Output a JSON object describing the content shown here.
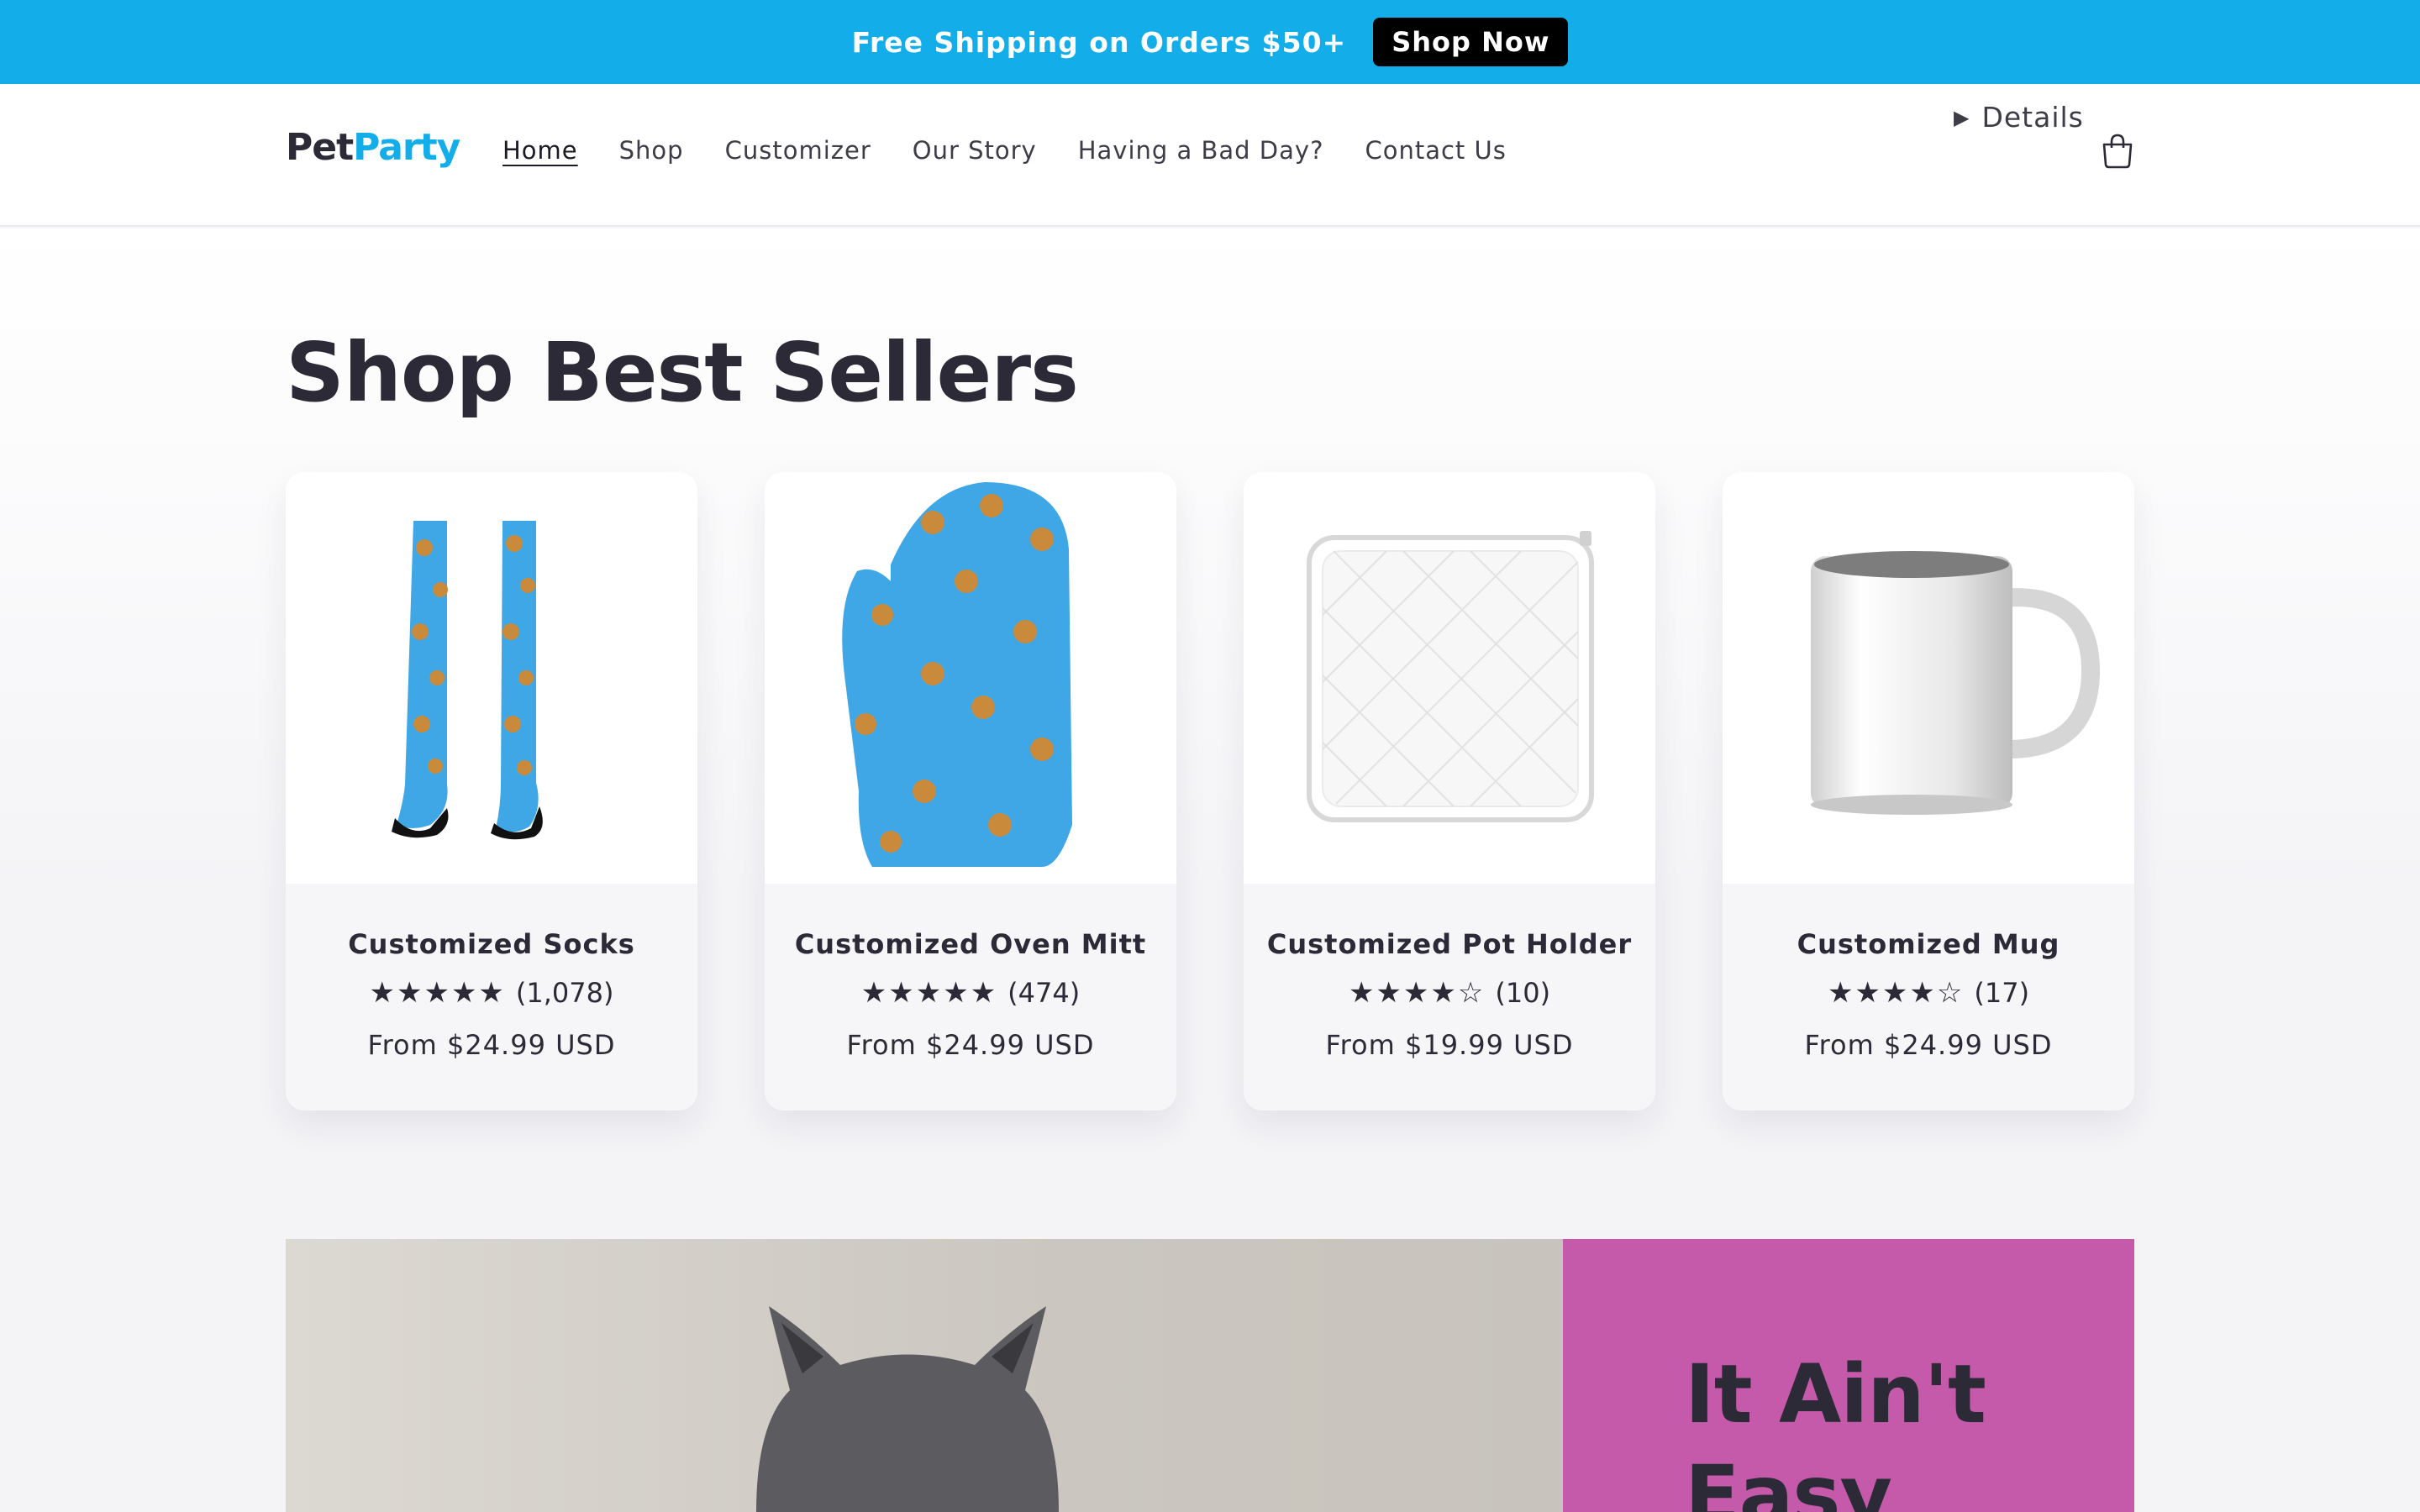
{
  "announcement": {
    "text": "Free Shipping on Orders $50+",
    "button": "Shop Now",
    "bg_color": "#13aeea"
  },
  "header": {
    "logo": {
      "part1": "Pet",
      "part2": "Party"
    },
    "nav": [
      "Home",
      "Shop",
      "Customizer",
      "Our Story",
      "Having a Bad Day?",
      "Contact Us"
    ],
    "active_nav": "Home",
    "details_label": "Details",
    "cart_icon": "cart-icon"
  },
  "best_sellers": {
    "title": "Shop Best Sellers",
    "products": [
      {
        "name": "Customized Socks",
        "stars": "★★★★★",
        "rating_count": "(1,078)",
        "price": "From $24.99 USD",
        "image": "socks"
      },
      {
        "name": "Customized Oven Mitt",
        "stars": "★★★★★",
        "rating_count": "(474)",
        "price": "From $24.99 USD",
        "image": "oven-mitt"
      },
      {
        "name": "Customized Pot Holder",
        "stars": "★★★★☆",
        "rating_count": "(10)",
        "price": "From $19.99 USD",
        "image": "pot-holder"
      },
      {
        "name": "Customized Mug",
        "stars": "★★★★☆",
        "rating_count": "(17)",
        "price": "From $24.99 USD",
        "image": "mug"
      }
    ]
  },
  "banner": {
    "heading_line1": "It Ain't",
    "heading_line2": "Easy",
    "panel_color": "#c55aaa"
  }
}
